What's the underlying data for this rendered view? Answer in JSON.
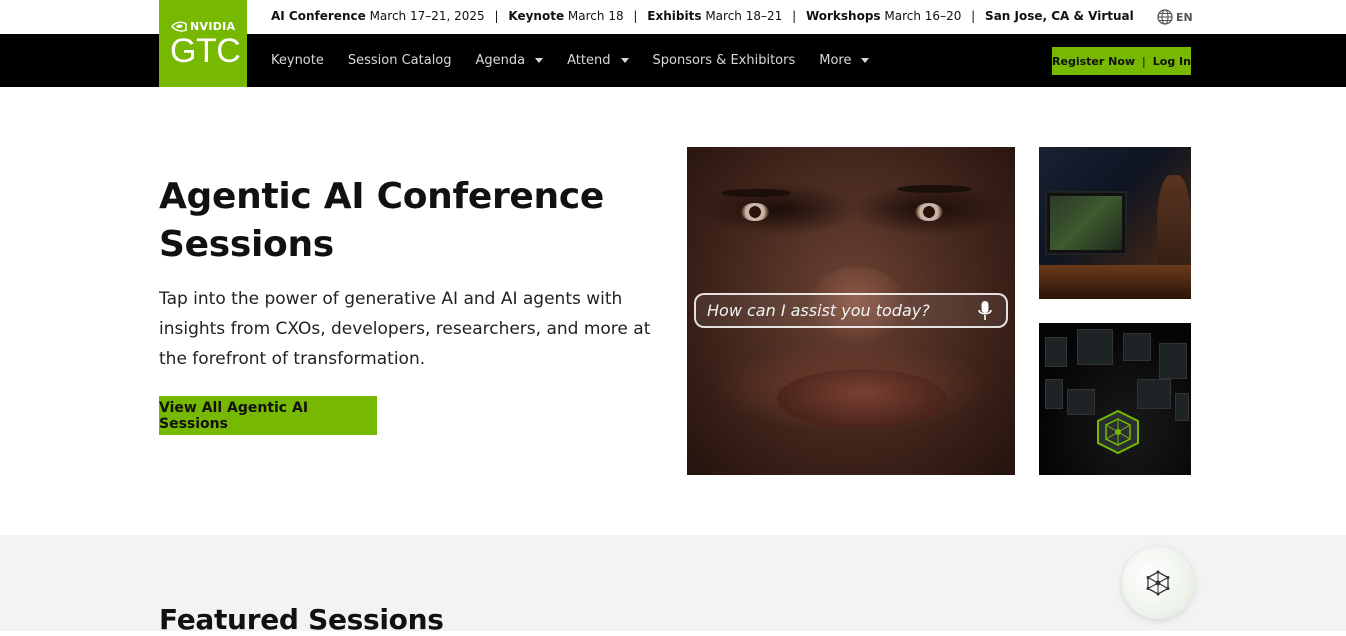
{
  "topbar": {
    "events": [
      {
        "label": "AI Conference",
        "value": "March 17–21, 2025"
      },
      {
        "label": "Keynote",
        "value": "March 18"
      },
      {
        "label": "Exhibits",
        "value": "March 18–21"
      },
      {
        "label": "Workshops",
        "value": "March 16–20"
      },
      {
        "label": "San Jose, CA & Virtual",
        "value": ""
      }
    ],
    "separator": "|",
    "language": "EN"
  },
  "logo": {
    "brand": "NVIDIA",
    "product": "GTC"
  },
  "nav": {
    "items": [
      {
        "label": "Keynote",
        "dropdown": false
      },
      {
        "label": "Session Catalog",
        "dropdown": false
      },
      {
        "label": "Agenda",
        "dropdown": true
      },
      {
        "label": "Attend",
        "dropdown": true
      },
      {
        "label": "Sponsors & Exhibitors",
        "dropdown": false
      },
      {
        "label": "More",
        "dropdown": true
      }
    ],
    "register_label": "Register Now",
    "cta_separator": "|",
    "login_label": "Log In"
  },
  "hero": {
    "title": "Agentic AI Conference Sessions",
    "description": "Tap into the power of generative AI and AI agents with insights from CXOs, developers, researchers, and more at the forefront of transformation.",
    "button_label": "View All Agentic AI Sessions",
    "assist_prompt": "How can I assist you today?"
  },
  "featured": {
    "title": "Featured Sessions"
  },
  "colors": {
    "accent": "#76b900",
    "nav_bg": "#000000",
    "section_bg": "#f3f3f3"
  },
  "icons": {
    "language": "globe-icon",
    "assist": "microphone-icon",
    "fab": "ai-network-icon"
  }
}
